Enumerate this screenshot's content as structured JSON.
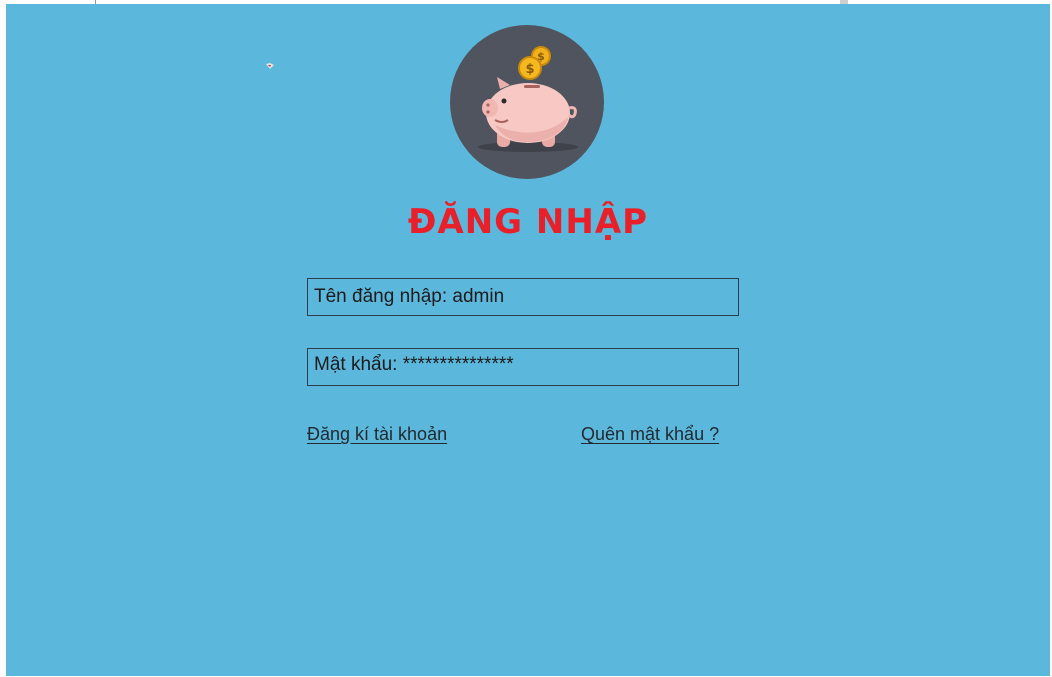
{
  "login": {
    "title": "ĐĂNG NHẬP",
    "username_field": "Tên đăng nhập: admin",
    "password_field": "Mật khẩu: ***************",
    "register_link": "Đăng kí tài khoản",
    "forgot_link": "Quên mật khẩu ?"
  },
  "logo": {
    "icon": "piggy-bank-icon",
    "colors": {
      "circle": "#50545e",
      "pig": "#f7c8c4",
      "coin": "#f2b11c"
    }
  },
  "theme": {
    "panel_background": "#5bb8dc",
    "title_color": "#e8202a",
    "text_color": "#1b1b1b"
  }
}
